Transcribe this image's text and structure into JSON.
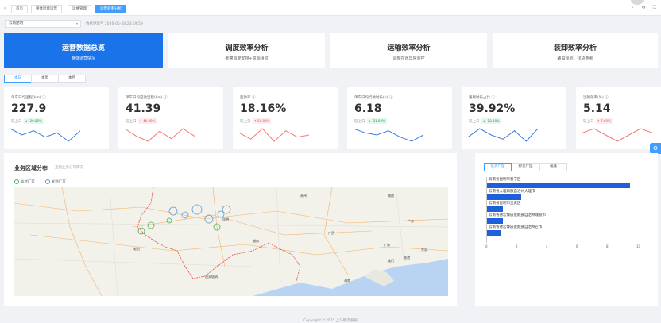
{
  "tabs": [
    "首页",
    "整体智能运营",
    "运维管理",
    "运营效率分析"
  ],
  "filter": {
    "value": "云南昆明"
  },
  "update_time": "数据更新至 2026-05-28 23:59:59",
  "modules": [
    {
      "title": "运营数据总览",
      "subtitle": "整体运营情况"
    },
    {
      "title": "调度效率分析",
      "subtitle": "考察调度安排+资源组织"
    },
    {
      "title": "运输效率分析",
      "subtitle": "调度在途异常监控"
    },
    {
      "title": "装卸效率分析",
      "subtitle": "路由规划，找货参考"
    }
  ],
  "periods": [
    "本日",
    "本周",
    "本月"
  ],
  "cards": [
    {
      "label": "单车日均里程(km)",
      "value": "227.9",
      "compare": "较上日",
      "change": "↓ -20.00%",
      "dir": "down",
      "color": "#3b7de0",
      "trend": [
        8,
        5,
        7,
        4,
        6,
        2,
        7
      ]
    },
    {
      "label": "单车日均空驶里程(km)",
      "value": "41.39",
      "compare": "较上日",
      "change": "↑ 40.00%",
      "dir": "up",
      "color": "#ee7b6f",
      "trend": [
        8,
        5,
        3,
        7,
        4,
        8,
        5
      ]
    },
    {
      "label": "空驶率",
      "value": "18.16%",
      "compare": "较上日",
      "change": "↑ 50.00%",
      "dir": "up",
      "color": "#ee7b6f",
      "trend": [
        6,
        3,
        8,
        2,
        7,
        4,
        5
      ]
    },
    {
      "label": "单车日均行驶时长(h)",
      "value": "6.18",
      "compare": "较上日",
      "change": "↓ -21.00%",
      "dir": "down",
      "color": "#3b7de0",
      "trend": [
        7,
        5,
        4,
        6,
        3,
        1,
        4
      ]
    },
    {
      "label": "重载时长占比",
      "value": "39.92%",
      "compare": "较上日",
      "change": "↓ -28.00%",
      "dir": "down",
      "color": "#3b7de0",
      "trend": [
        4,
        8,
        5,
        3,
        7,
        2,
        8
      ]
    },
    {
      "label": "运输效率(%)",
      "value": "5.14",
      "compare": "较上日",
      "change": "↑ 7.69%",
      "dir": "up",
      "color": "#ee7b6f",
      "trend": [
        6,
        8,
        5,
        2,
        5,
        8,
        6
      ]
    }
  ],
  "map": {
    "title": "业务区域分布",
    "subtitle": "查看业务分布情况",
    "legend": [
      {
        "label": "装货厂区",
        "color": "#4caf50"
      },
      {
        "label": "卸货厂区",
        "color": "#5b9bd5"
      }
    ],
    "places": [
      "西双版纳",
      "老挝",
      "越南",
      "广西",
      "广州",
      "海南",
      "香港",
      "澳门",
      "广东",
      "昆明",
      "贵州",
      "湖南",
      "东莞"
    ]
  },
  "rank": {
    "tabs": [
      "装货厂区",
      "卸货厂区",
      "线路"
    ],
    "items": [
      {
        "label": "云南省昆明市晋宁区",
        "value": 9.5
      },
      {
        "label": "云南省大理白族自治州大理市",
        "value": 2.3
      },
      {
        "label": "云南省昆明市呈贡区",
        "value": 1.1
      },
      {
        "label": "云南省德宏傣族景颇族自治州瑞丽市",
        "value": 1.1
      },
      {
        "label": "云南省德宏傣族景颇族自治州芒市",
        "value": 1.0
      }
    ],
    "ticks": [
      "0",
      "2",
      "4",
      "6",
      "8",
      "10"
    ],
    "max": 10
  },
  "footer": "Copyright ©2025 上马物流系统"
}
